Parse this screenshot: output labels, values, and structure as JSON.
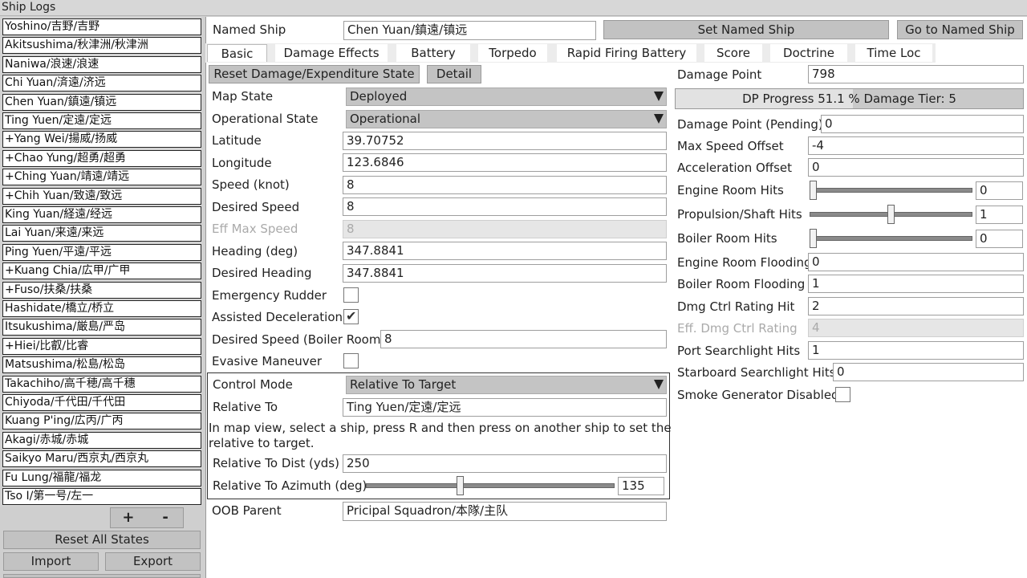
{
  "window": {
    "title": "Ship Logs"
  },
  "ships": [
    "Yoshino/吉野/吉野",
    "Akitsushima/秋津洲/秋津洲",
    "Naniwa/浪速/浪速",
    "Chi Yuan/済遠/济远",
    "Chen Yuan/鎮遠/镇远",
    "Ting Yuen/定遠/定远",
    "+Yang Wei/揚威/扬威",
    "+Chao Yung/超勇/超勇",
    "+Ching Yuan/靖遠/靖远",
    "+Chih Yuan/致遠/致远",
    "King Yuan/経遠/经远",
    "Lai Yuan/来遠/来远",
    "Ping Yuen/平遠/平远",
    "+Kuang Chia/広甲/广甲",
    "+Fuso/扶桑/扶桑",
    "Hashidate/橋立/桥立",
    "Itsukushima/厳島/严岛",
    "+Hiei/比叡/比睿",
    "Matsushima/松島/松岛",
    "Takachiho/高千穂/高千穗",
    "Chiyoda/千代田/千代田",
    "Kuang P'ing/広丙/广丙",
    "Akagi/赤城/赤城",
    "Saikyo Maru/西京丸/西京丸",
    "Fu Lung/福龍/福龙",
    "Tso I/第一号/左一"
  ],
  "list_buttons": {
    "add": "+",
    "remove": "-",
    "reset_all": "Reset All States",
    "import": "Import",
    "export": "Export"
  },
  "header": {
    "named_ship_label": "Named Ship",
    "named_ship_value": "Chen Yuan/鎮遠/镇远",
    "set_button": "Set Named Ship",
    "goto_button": "Go to Named Ship"
  },
  "tabs": [
    "Basic",
    "Damage Effects",
    "Battery",
    "Torpedo",
    "Rapid Firing Battery",
    "Score",
    "Doctrine",
    "Time Loc"
  ],
  "basic": {
    "reset_button": "Reset Damage/Expenditure State",
    "detail_button": "Detail",
    "map_state_label": "Map State",
    "map_state_value": "Deployed",
    "op_state_label": "Operational State",
    "op_state_value": "Operational",
    "latitude_label": "Latitude",
    "latitude_value": "39.70752",
    "longitude_label": "Longitude",
    "longitude_value": "123.6846",
    "speed_label": "Speed (knot)",
    "speed_value": "8",
    "desired_speed_label": "Desired Speed",
    "desired_speed_value": "8",
    "eff_max_speed_label": "Eff Max Speed",
    "eff_max_speed_value": "8",
    "heading_label": "Heading (deg)",
    "heading_value": "347.8841",
    "desired_heading_label": "Desired Heading",
    "desired_heading_value": "347.8841",
    "emergency_rudder_label": "Emergency Rudder",
    "assisted_decel_label": "Assisted Deceleration",
    "desired_speed_boiler_label": "Desired Speed (Boiler Room)",
    "desired_speed_boiler_value": "8",
    "evasive_label": "Evasive Maneuver",
    "control_mode_label": "Control Mode",
    "control_mode_value": "Relative To Target",
    "relative_to_label": "Relative To",
    "relative_to_value": "Ting Yuen/定遠/定远",
    "note_line1": "In map view, select a ship, press R and then press on another ship to set the",
    "note_line2": "relative to target.",
    "rel_dist_label": "Relative To Dist (yds)",
    "rel_dist_value": "250",
    "rel_azimuth_label": "Relative To Azimuth (deg)",
    "rel_azimuth_value": "135",
    "rel_azimuth_fraction": 0.375,
    "oob_parent_label": "OOB Parent",
    "oob_parent_value": "Pricipal Squadron/本隊/主队"
  },
  "damage": {
    "damage_point_label": "Damage Point",
    "damage_point_value": "798",
    "progress_text": "DP Progress 51.1 % Damage Tier: 5",
    "progress_fraction": 0.511,
    "dp_pending_label": "Damage Point (Pending)",
    "dp_pending_value": "0",
    "max_speed_offset_label": "Max Speed Offset",
    "max_speed_offset_value": "-4",
    "accel_offset_label": "Acceleration Offset",
    "accel_offset_value": "0",
    "engine_hits_label": "Engine Room Hits",
    "engine_hits_value": "0",
    "engine_hits_fraction": 0.0,
    "propulsion_hits_label": "Propulsion/Shaft Hits",
    "propulsion_hits_value": "1",
    "propulsion_hits_fraction": 0.5,
    "boiler_hits_label": "Boiler Room Hits",
    "boiler_hits_value": "0",
    "boiler_hits_fraction": 0.0,
    "engine_flooding_label": "Engine Room Flooding",
    "engine_flooding_value": "0",
    "boiler_flooding_label": "Boiler Room Flooding",
    "boiler_flooding_value": "1",
    "dmg_ctrl_hit_label": "Dmg Ctrl Rating Hit",
    "dmg_ctrl_hit_value": "2",
    "eff_dmg_ctrl_label": "Eff. Dmg Ctrl Rating",
    "eff_dmg_ctrl_value": "4",
    "port_search_label": "Port Searchlight Hits",
    "port_search_value": "1",
    "stbd_search_label": "Starboard Searchlight Hits",
    "stbd_search_value": "0",
    "smoke_label": "Smoke Generator Disabled"
  },
  "states": {
    "emergency_rudder_checked": false,
    "assisted_decel_checked": true,
    "evasive_checked": false,
    "smoke_checked": false
  }
}
